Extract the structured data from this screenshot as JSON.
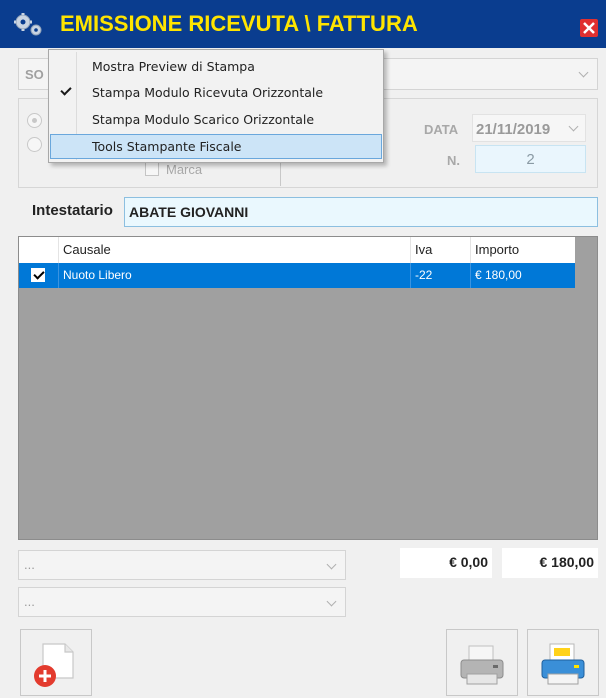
{
  "window": {
    "title": "EMISSIONE RICEVUTA \\ FATTURA",
    "title_color": "#ffe400",
    "titlebar_color": "#0a3d8f"
  },
  "context_menu": {
    "items": [
      {
        "label": "Mostra Preview di Stampa",
        "checked": false,
        "highlighted": false
      },
      {
        "label": "Stampa Modulo Ricevuta Orizzontale",
        "checked": true,
        "highlighted": false
      },
      {
        "label": "Stampa Modulo Scarico Orizzontale",
        "checked": false,
        "highlighted": false
      },
      {
        "label": "Tools Stampante Fiscale",
        "checked": false,
        "highlighted": true
      }
    ]
  },
  "form": {
    "so_select_text": "SO",
    "marca_label": "Marca",
    "data_label": "DATA",
    "data_value": "21/11/2019",
    "n_label": "N.",
    "n_value": "2",
    "intestatario_label": "Intestatario",
    "intestatario_value": "ABATE GIOVANNI"
  },
  "grid": {
    "columns": [
      "Causale",
      "Iva",
      "Importo"
    ],
    "rows": [
      {
        "checked": true,
        "causale": "Nuoto Libero",
        "iva": "-22",
        "importo": "€ 180,00",
        "selected": true
      }
    ],
    "selection_color": "#0078d7"
  },
  "totals": {
    "total_1": "€ 0,00",
    "total_2": "€ 180,00"
  },
  "combos": {
    "combo_1": "...",
    "combo_2": "..."
  },
  "buttons": {
    "delete_icon": "document-delete-icon",
    "print_icon": "printer-icon",
    "print_color_icon": "printer-color-icon"
  }
}
